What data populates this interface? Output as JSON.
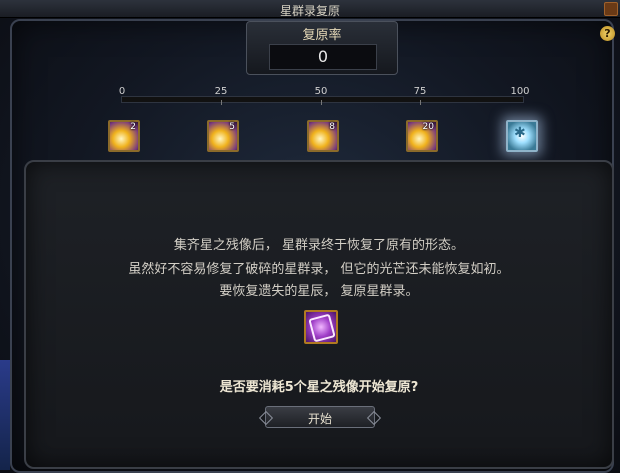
{
  "window": {
    "title": "星群录复原"
  },
  "rate": {
    "label": "复原率",
    "value": "0"
  },
  "progress": {
    "value": 0,
    "ticks": [
      "0",
      "25",
      "50",
      "75",
      "100"
    ],
    "rewards": [
      {
        "count": "2",
        "icon": "star-burst-icon"
      },
      {
        "count": "5",
        "icon": "star-burst-icon"
      },
      {
        "count": "8",
        "icon": "star-burst-icon"
      },
      {
        "count": "20",
        "icon": "star-burst-icon"
      },
      {
        "count": "",
        "icon": "crystal-star-icon"
      }
    ]
  },
  "description": {
    "line1": "集齐星之残像后，   星群录终于恢复了原有的形态。",
    "line2": "虽然好不容易修复了破碎的星群录，   但它的光芒还未能恢复如初。",
    "line3": "要恢复遗失的星辰，   复原星群录。"
  },
  "material": {
    "icon": "star-remnant-icon"
  },
  "question": "是否要消耗5个星之残像开始复原?",
  "buttons": {
    "start": "开始",
    "help": "?"
  },
  "colors": {
    "accent": "#d6b64a",
    "text": "#d3cfc6"
  }
}
